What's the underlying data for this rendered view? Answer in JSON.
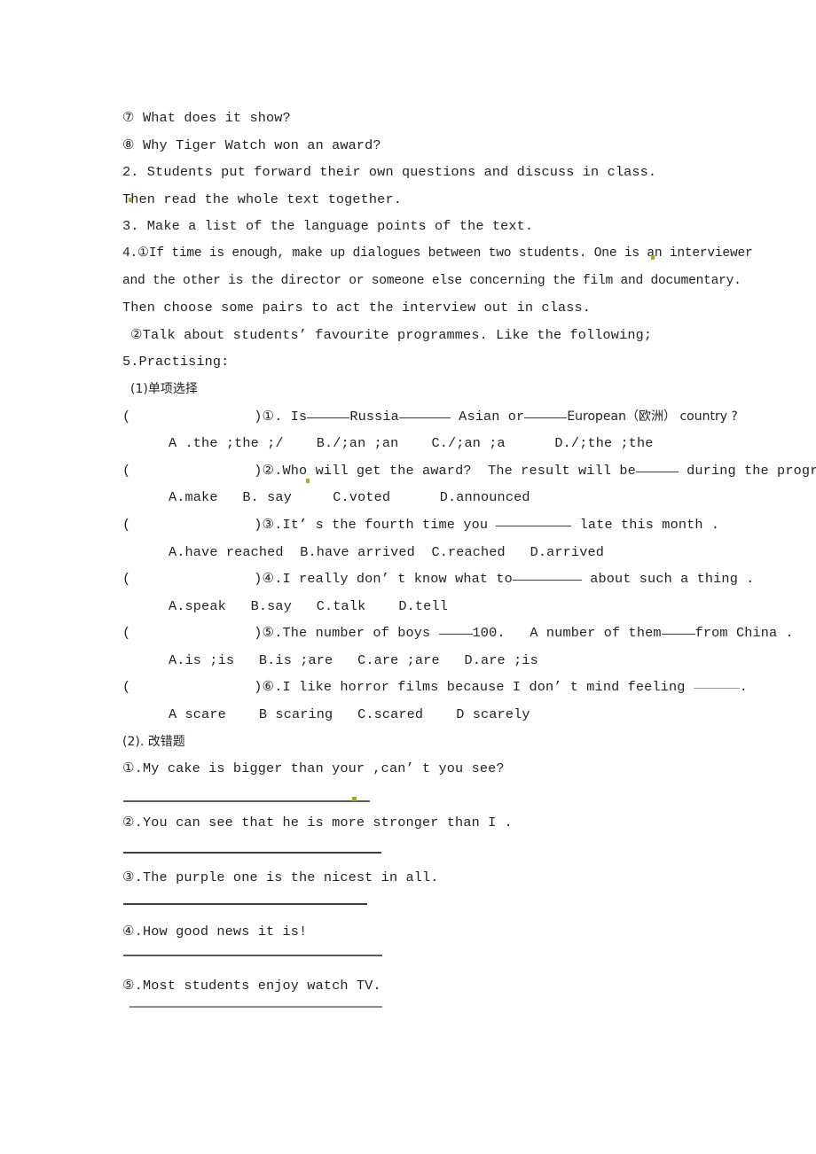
{
  "document": {
    "language": "English / Chinese",
    "text_color": "#231f20",
    "background": "#ffffff"
  },
  "lines": {
    "q7": "⑦ What does it show?",
    "q8": "⑧ Why Tiger Watch won an award?",
    "item2": "2. Students put forward their own questions and discuss in class.",
    "item2b": "Then read the whole text together.",
    "item3": "3. Make a list of the language points of the text.",
    "item4a": "4.①If time is enough, make up dialogues between two students. One is an interviewer",
    "item4b": "and the other is the director or someone else concerning the film and documentary.",
    "item4c": "Then choose some pairs to act the interview out in class.",
    "item4d": "②Talk about students’ favourite programmes. Like the following;",
    "item5": "5.Practising:",
    "sub1": "(1)单项选择",
    "sub2": "(2). 改错题"
  },
  "multiple_choice": [
    {
      "paren_open": "(",
      "paren_close": ")",
      "number": "①",
      "stem_parts": [
        "Is",
        "Russia",
        " Asian or",
        "European（欧洲） country ?"
      ],
      "options": "A .the ;the ;/    B./;an ;an    C./;an ;a      D./;the ;the"
    },
    {
      "paren_open": "(",
      "paren_close": ")",
      "number": "②",
      "stem_parts": [
        "Who will get the award?  The result will be",
        " during the program."
      ],
      "options": "A.make   B. say     C.voted      D.announced"
    },
    {
      "paren_open": "(",
      "paren_close": ")",
      "number": "③",
      "stem_parts": [
        "It’ s the fourth time you ",
        " late this month ."
      ],
      "options": "A.have reached  B.have arrived  C.reached   D.arrived"
    },
    {
      "paren_open": "(",
      "paren_close": ")",
      "number": "④",
      "stem_parts": [
        "I really don’ t know what to",
        " about such a thing ."
      ],
      "options": "A.speak   B.say   C.talk    D.tell"
    },
    {
      "paren_open": "(",
      "paren_close": ")",
      "number": "⑤",
      "stem_parts": [
        "The number of boys ",
        "100.   A number of them",
        "from China ."
      ],
      "options": "A.is ;is   B.is ;are   C.are ;are   D.are ;is"
    },
    {
      "paren_open": "(",
      "paren_close": ")",
      "number": "⑥",
      "stem_parts": [
        "I like horror films because I don’ t mind feeling ",
        "."
      ],
      "options": "A scare    B scaring   C.scared    D scarely"
    }
  ],
  "error_correction": [
    {
      "number": "①",
      "sentence": ".My cake is bigger than your ,can’ t you see?"
    },
    {
      "number": "②",
      "sentence": ".You can see that he is more stronger than I ."
    },
    {
      "number": "③",
      "sentence": ".The purple one is the nicest in all."
    },
    {
      "number": "④",
      "sentence": ".How good news it is!"
    },
    {
      "number": "⑤",
      "sentence": ".Most students enjoy watch TV."
    }
  ]
}
